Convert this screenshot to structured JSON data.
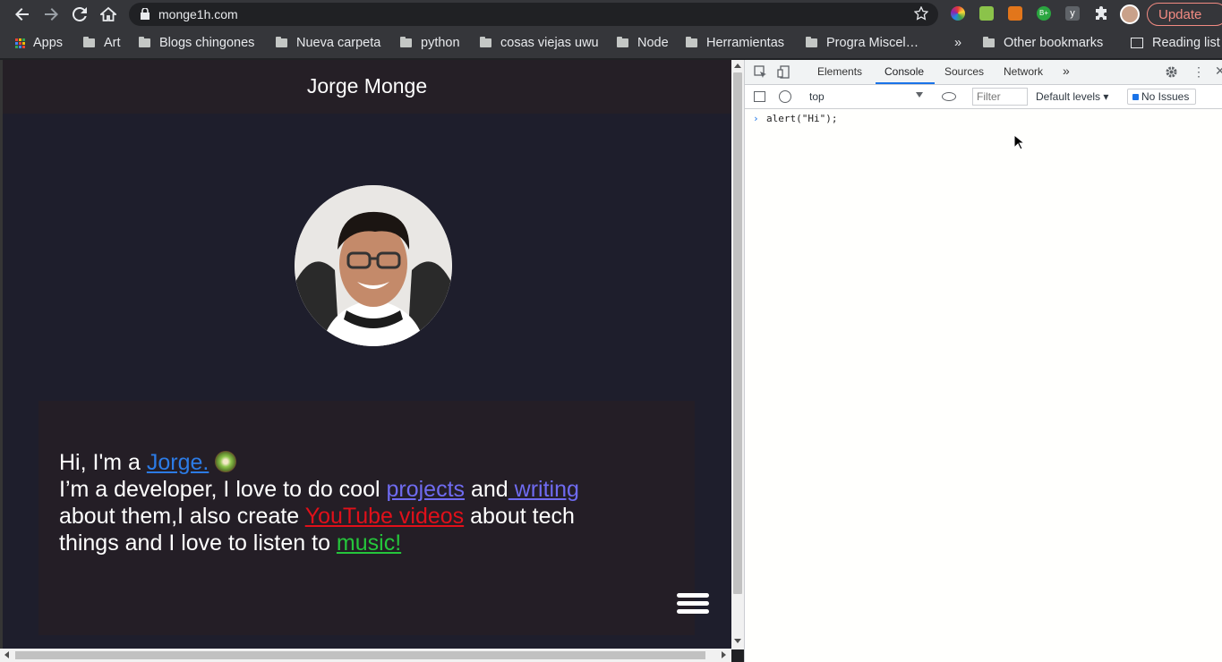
{
  "browser": {
    "url": "monge1h.com",
    "update_label": "Update",
    "bookmarks": [
      "Apps",
      "Art",
      "Blogs chingones",
      "Nueva carpeta",
      "python",
      "cosas viejas uwu",
      "Node",
      "Herramientas",
      "Progra Miscel…"
    ],
    "other_bookmarks": "Other bookmarks",
    "reading_list": "Reading list",
    "overflow": "»"
  },
  "site": {
    "header_title": "Jorge Monge",
    "intro": {
      "line1_prefix": "Hi, I'm a ",
      "name_link": "Jorge.",
      "emoji": "🥝",
      "line2_prefix": "I’m a developer, I love to do cool ",
      "projects_link": "projects",
      "and": " and",
      "writing_link": " writing",
      "line3_prefix": "about them,I also create ",
      "youtube_link": "YouTube videos",
      "line3_suffix": " about tech",
      "line4_prefix": "things and I love to listen to ",
      "music_link": "music!"
    },
    "colors": {
      "name": "#2c7be5",
      "projects": "#6f6bf0",
      "youtube": "#e0101a",
      "music": "#25c63b"
    }
  },
  "devtools": {
    "tabs": [
      "Elements",
      "Console",
      "Sources",
      "Network"
    ],
    "active_tab": "Console",
    "context": "top",
    "filter_placeholder": "Filter",
    "levels": "Default levels ▾",
    "issues": "No Issues",
    "console_input": "alert(\"Hi\");"
  }
}
